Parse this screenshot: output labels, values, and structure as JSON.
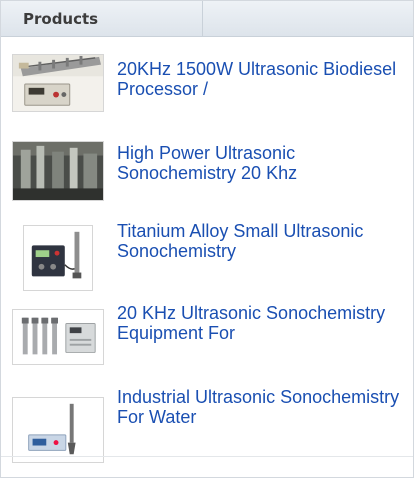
{
  "panel": {
    "title": "Products"
  },
  "products": [
    {
      "name": "20KHz 1500W Ultrasonic Biodiesel Processor /",
      "image_icon": "ultrasonic-processor-image"
    },
    {
      "name": "High Power Ultrasonic Sonochemistry 20 Khz",
      "image_icon": "sonochemistry-equipment-image"
    },
    {
      "name": "Titanium Alloy Small Ultrasonic Sonochemistry",
      "image_icon": "generator-and-probe-image"
    },
    {
      "name": "20 KHz Ultrasonic Sonochemistry Equipment For",
      "image_icon": "probes-and-generator-image"
    },
    {
      "name": "Industrial Ultrasonic Sonochemistry For Water",
      "image_icon": "probe-and-generator-image"
    }
  ],
  "colors": {
    "link": "#1a4fb2",
    "header_bg": "#e4e9ee",
    "border": "#d3d8de"
  }
}
